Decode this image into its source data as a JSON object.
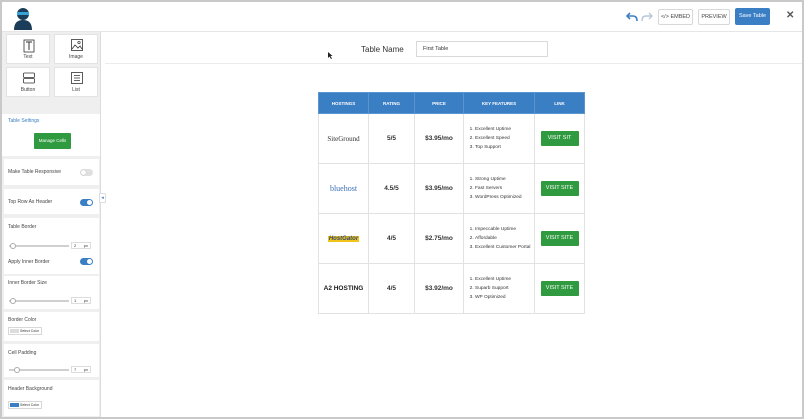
{
  "toolbar": {
    "embed_label": "</> EMBED",
    "preview_label": "PREVIEW",
    "save_label": "Save Table",
    "close_label": "✕"
  },
  "sidebar": {
    "widgets": [
      {
        "label": "Text",
        "icon": "text-icon"
      },
      {
        "label": "Image",
        "icon": "image-icon"
      },
      {
        "label": "Button",
        "icon": "button-icon"
      },
      {
        "label": "List",
        "icon": "list-icon"
      }
    ],
    "settings_title": "Table Settings",
    "manage_cells_label": "Manage Cells",
    "make_responsive_label": "Make Table Responsive",
    "make_responsive_on": false,
    "top_row_header_label": "Top Row As Header",
    "top_row_header_on": true,
    "table_border_label": "Table Border",
    "table_border_value": "2",
    "unit": "px",
    "apply_inner_border_label": "Apply Inner Border",
    "apply_inner_border_on": true,
    "inner_border_size_label": "Inner Border Size",
    "inner_border_size_value": "1",
    "border_color_label": "Border Color",
    "border_color_button": "Select Color",
    "border_color": "#dcdcdc",
    "cell_padding_label": "Cell Padding",
    "cell_padding_value": "7",
    "header_background_label": "Header Background",
    "header_background_button": "Select Color",
    "header_background_color": "#3a7ec4"
  },
  "main": {
    "table_name_label": "Table Name",
    "table_name_value": "First Table"
  },
  "table": {
    "headers": [
      "HOSTINGS",
      "RATING",
      "PRICE",
      "KEY FEATURES",
      "LINK"
    ],
    "rows": [
      {
        "logo": "SiteGround",
        "rating": "5/5",
        "price": "$3.95/mo",
        "features": [
          "Excellent Uptime",
          "Excellent Speed",
          "Top Support"
        ],
        "link": "VISIT SIT"
      },
      {
        "logo": "bluehost",
        "rating": "4.5/5",
        "price": "$3.95/mo",
        "features": [
          "Strong Uptime",
          "Fast Servers",
          "WordPress Optimized"
        ],
        "link": "VISIT SITE"
      },
      {
        "logo": "HostGator",
        "rating": "4/5",
        "price": "$2.75/mo",
        "features": [
          "Impeccable Uptime",
          "Affordable",
          "Excellent Customer Portal"
        ],
        "link": "VISIT SITE"
      },
      {
        "logo": "A2 HOSTING",
        "rating": "4/5",
        "price": "$3.92/mo",
        "features": [
          "Excellent Uptime",
          "Suparb Support",
          "WP Optimized"
        ],
        "link": "VISIT SITE"
      }
    ]
  },
  "colors": {
    "accent": "#3a7ec4",
    "success": "#2f9a3f"
  }
}
